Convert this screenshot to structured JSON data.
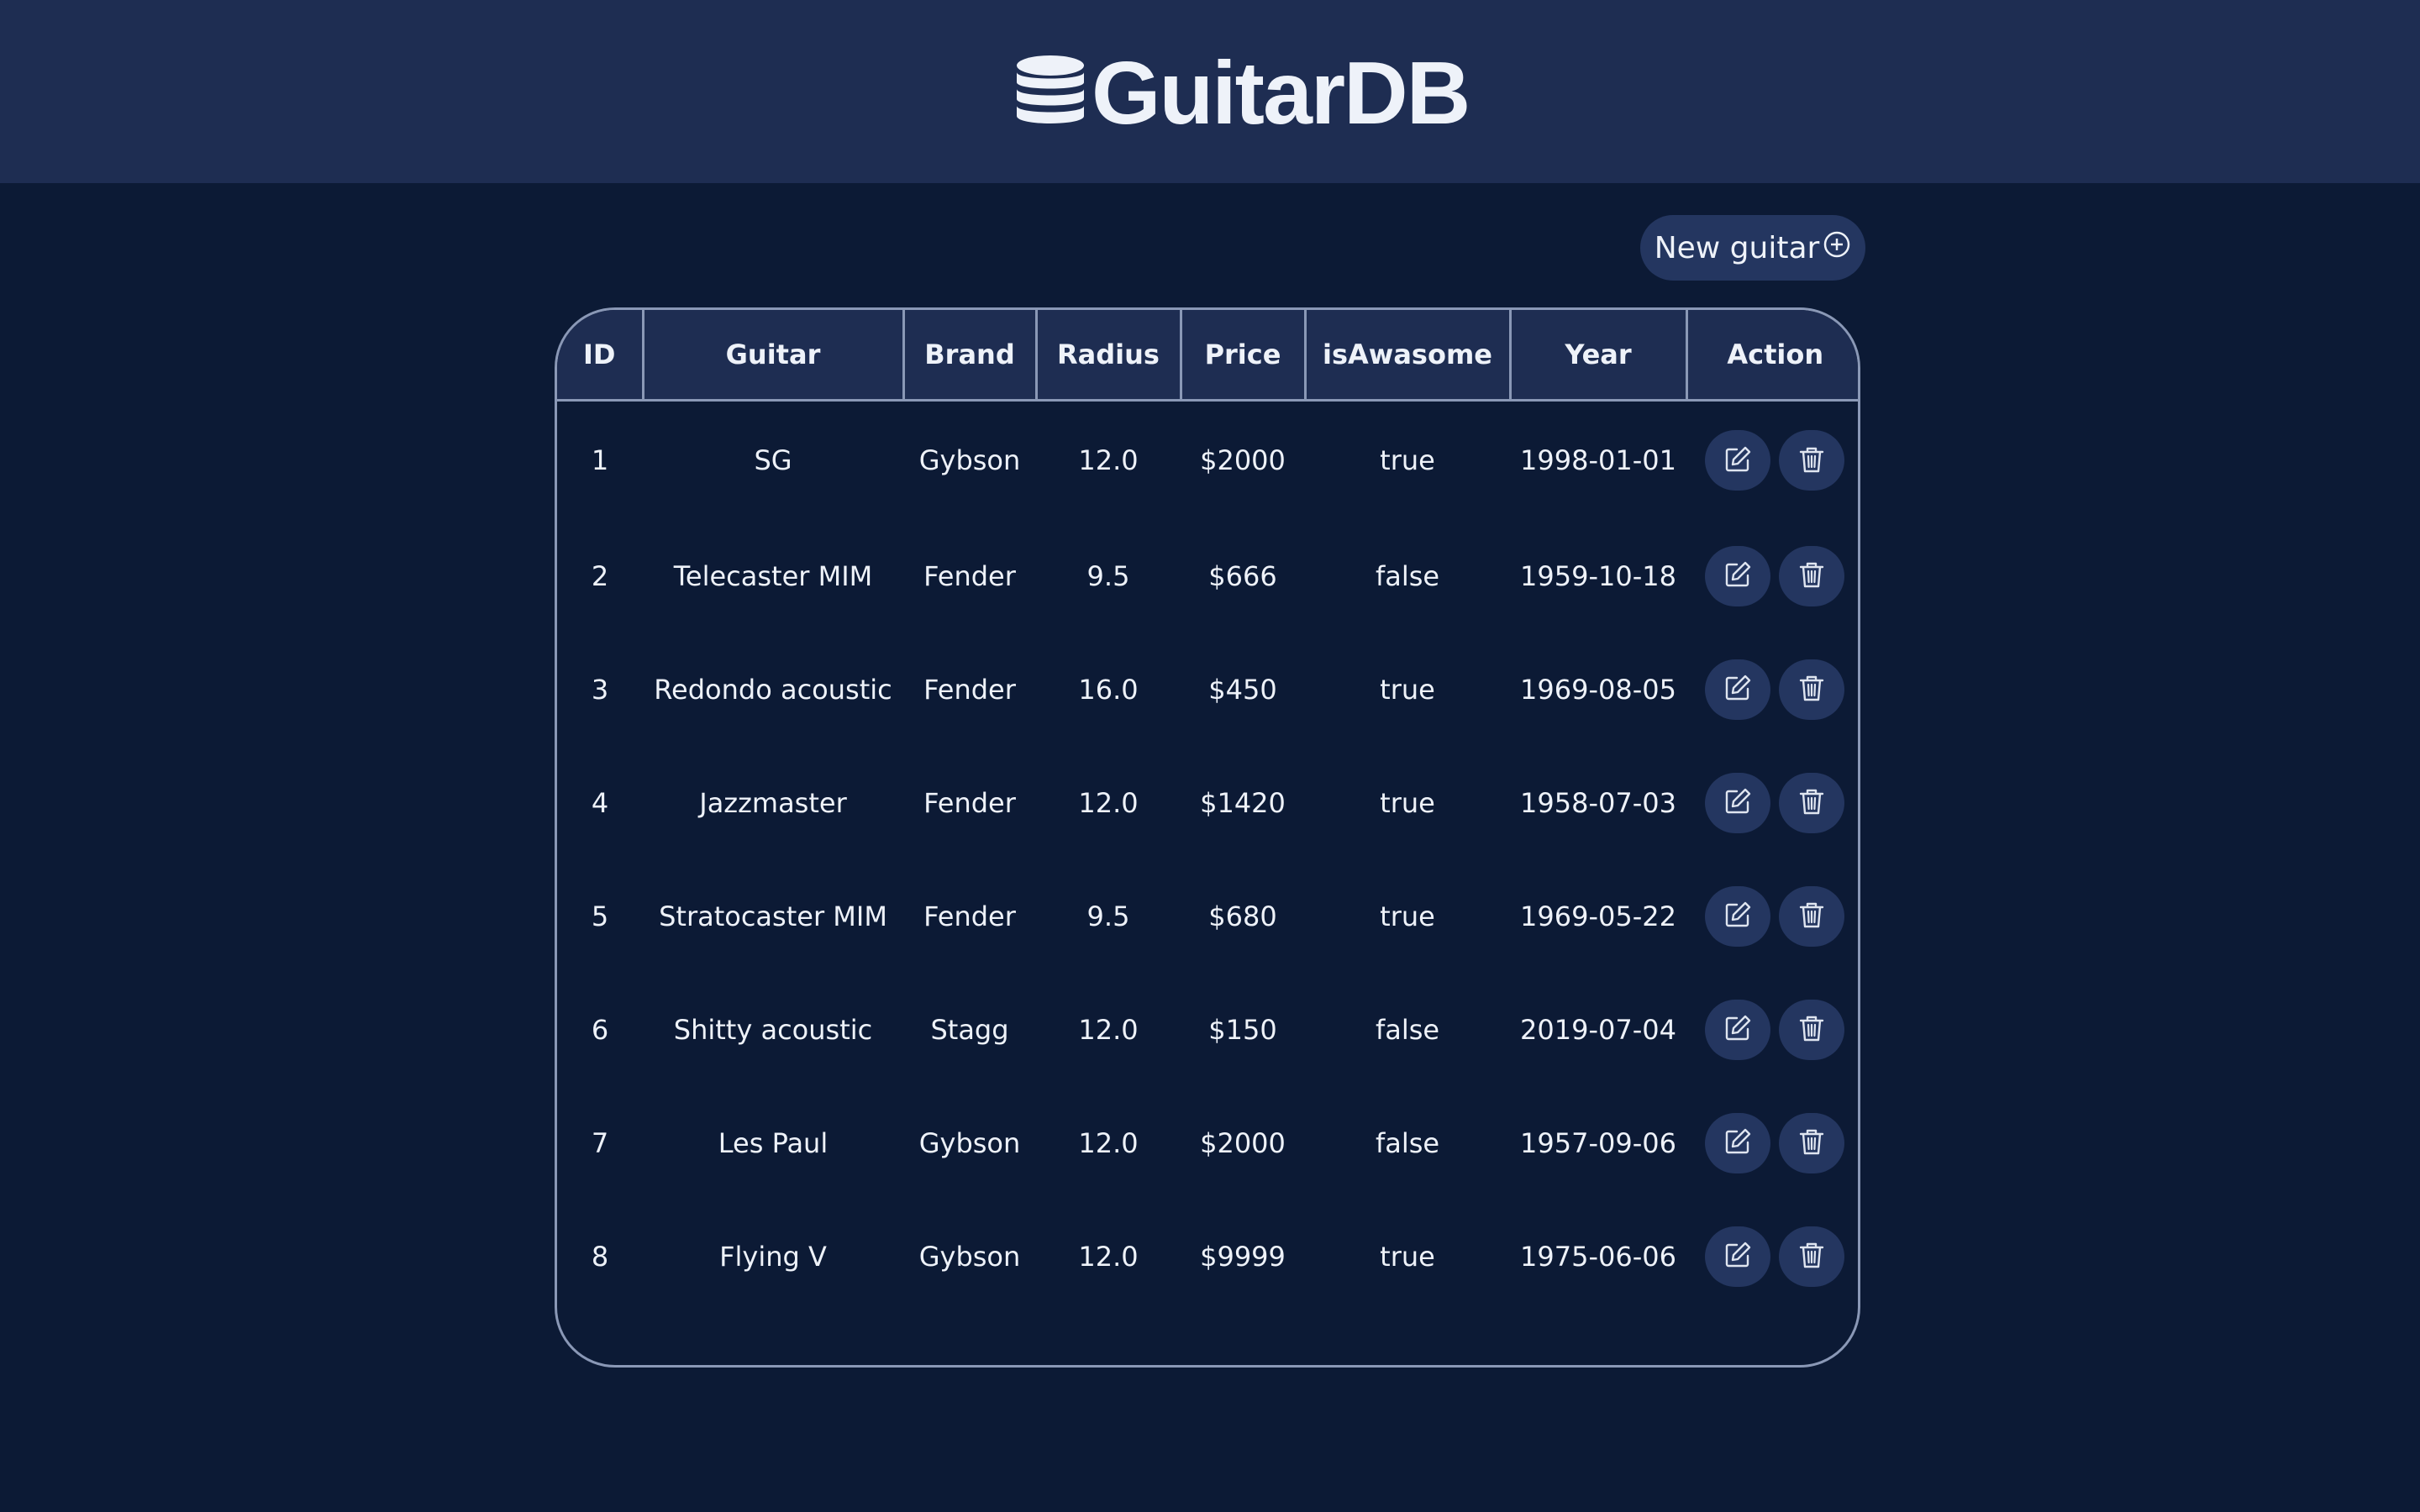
{
  "app": {
    "title": "GuitarDB",
    "logo_icon": "database-icon",
    "accent_color": "#2f6fd6"
  },
  "toolbar": {
    "new_label": "New guitar",
    "new_icon": "plus-circle-icon"
  },
  "table": {
    "columns": [
      "ID",
      "Guitar",
      "Brand",
      "Radius",
      "Price",
      "isAwasome",
      "Year",
      "Action"
    ],
    "action_icons": [
      "edit-icon",
      "trash-icon"
    ],
    "rows": [
      {
        "id": "1",
        "guitar": "SG",
        "brand": "Gybson",
        "radius": "12.0",
        "price": "$2000",
        "awesome": "true",
        "year": "1998-01-01"
      },
      {
        "id": "2",
        "guitar": "Telecaster MIM",
        "brand": "Fender",
        "radius": "9.5",
        "price": "$666",
        "awesome": "false",
        "year": "1959-10-18"
      },
      {
        "id": "3",
        "guitar": "Redondo acoustic",
        "brand": "Fender",
        "radius": "16.0",
        "price": "$450",
        "awesome": "true",
        "year": "1969-08-05"
      },
      {
        "id": "4",
        "guitar": "Jazzmaster",
        "brand": "Fender",
        "radius": "12.0",
        "price": "$1420",
        "awesome": "true",
        "year": "1958-07-03"
      },
      {
        "id": "5",
        "guitar": "Stratocaster MIM",
        "brand": "Fender",
        "radius": "9.5",
        "price": "$680",
        "awesome": "true",
        "year": "1969-05-22"
      },
      {
        "id": "6",
        "guitar": "Shitty acoustic",
        "brand": "Stagg",
        "radius": "12.0",
        "price": "$150",
        "awesome": "false",
        "year": "2019-07-04"
      },
      {
        "id": "7",
        "guitar": "Les Paul",
        "brand": "Gybson",
        "radius": "12.0",
        "price": "$2000",
        "awesome": "false",
        "year": "1957-09-06"
      },
      {
        "id": "8",
        "guitar": "Flying V",
        "brand": "Gybson",
        "radius": "12.0",
        "price": "$9999",
        "awesome": "true",
        "year": "1975-06-06"
      }
    ]
  }
}
